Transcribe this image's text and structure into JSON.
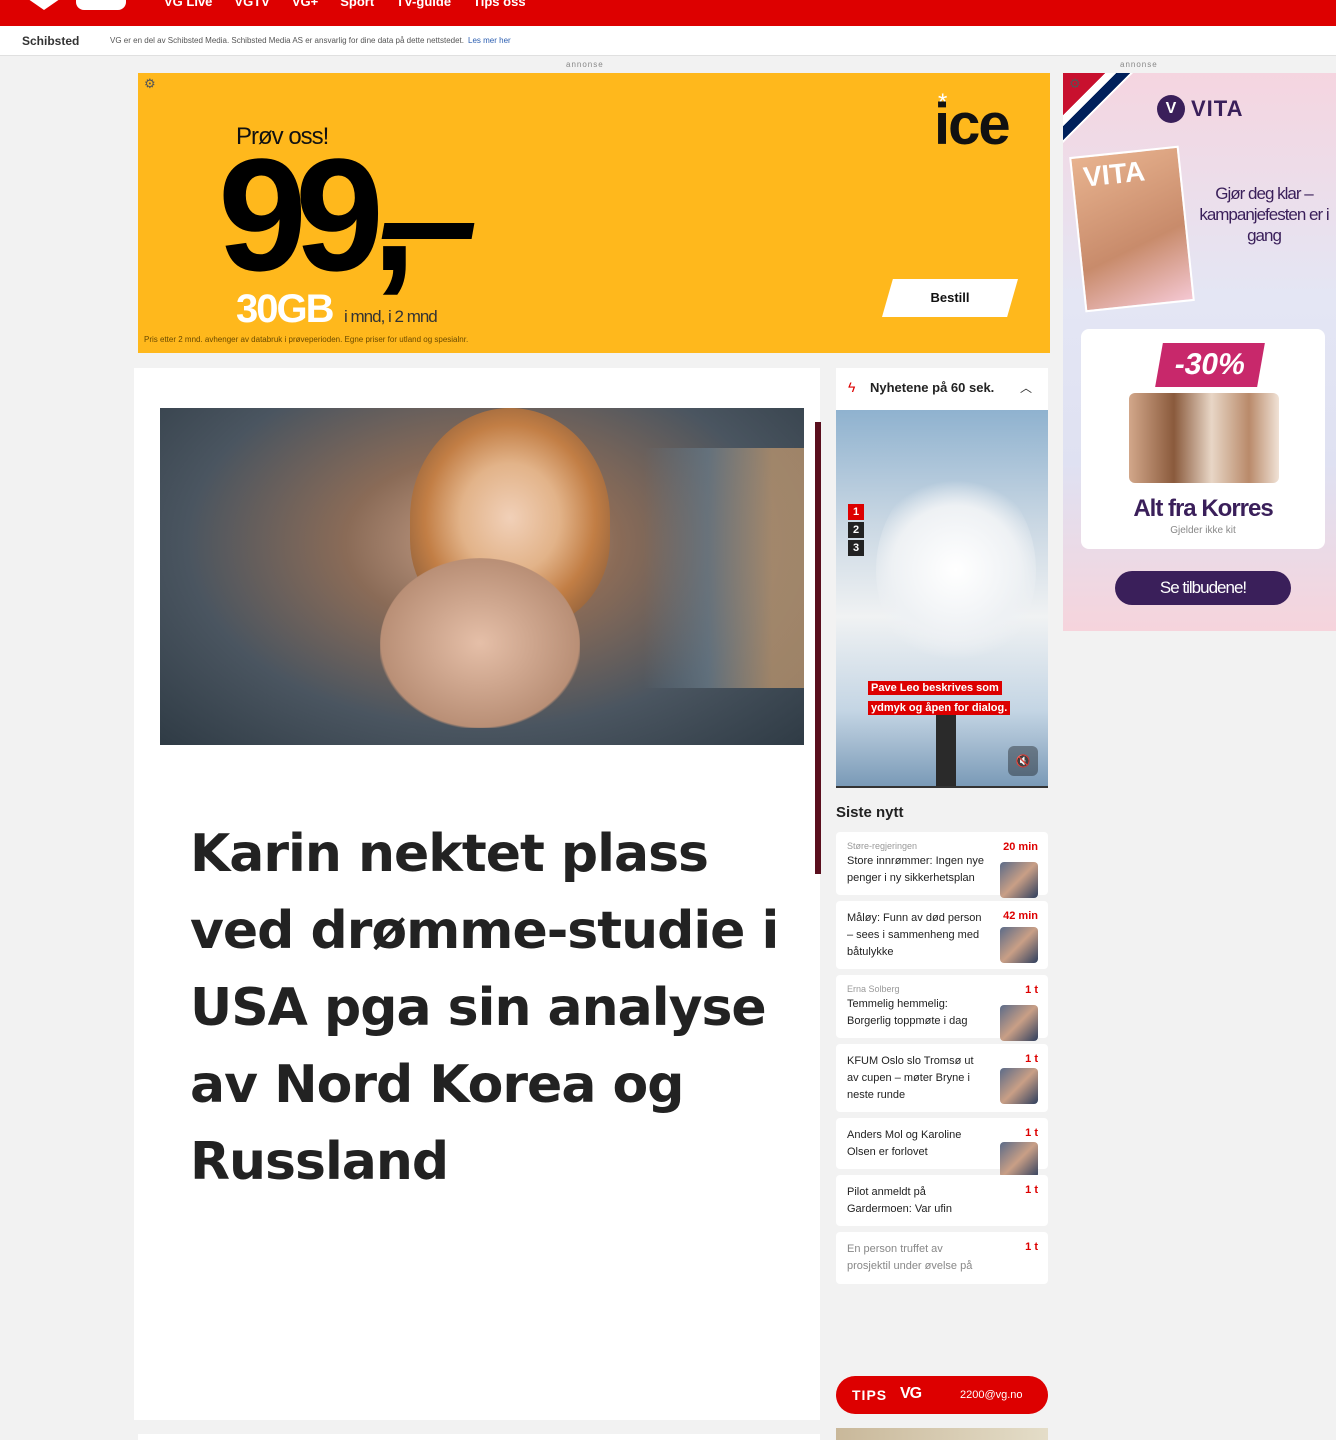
{
  "nav": {
    "links": [
      "VG Live",
      "VGTV",
      "VG+",
      "Sport",
      "TV-guide",
      "Tips oss"
    ]
  },
  "schibsted": {
    "logo": "Schibsted",
    "text": "VG er en del av Schibsted Media. Schibsted Media AS er ansvarlig for dine data på dette nettstedet.",
    "link": "Les mer her"
  },
  "ads": {
    "label": "annonse",
    "ice": {
      "prov": "Prøv oss!",
      "price": "99,",
      "gb": "30GB",
      "gb_sub": "i mnd, i 2 mnd",
      "logo": "ice",
      "button": "Bestill",
      "fine": "Pris etter 2 mnd. avhenger av databruk i prøveperioden. Egne priser for utland og spesialnr."
    },
    "vita": {
      "logo": "VITA",
      "mag": "VITA",
      "tagline": "Gjør deg klar – kampanjefesten er i gang",
      "badge": "-30%",
      "product": "Alt fra Korres",
      "note": "Gjelder ikke kit",
      "cta": "Se tilbudene!"
    }
  },
  "article": {
    "title": "Karin nektet plass ved drømme-studie i USA pga sin analyse av Nord Korea og Russland"
  },
  "news60": {
    "label": "Nyhetene på 60 sek.",
    "numbers": [
      "1",
      "2",
      "3"
    ],
    "caption": "Pave Leo beskrives som ydmyk og åpen for dialog."
  },
  "siste": {
    "heading": "Siste nytt",
    "items": [
      {
        "kicker": "Støre-regjeringen",
        "title": "Store innrømmer: Ingen nye penger i ny sikkerhetsplan",
        "time": "20 min"
      },
      {
        "kicker": "",
        "title": "Måløy: Funn av død person – sees i sammenheng med båtulykke",
        "time": "42 min"
      },
      {
        "kicker": "Erna Solberg",
        "title": "Temmelig hemmelig: Borgerlig toppmøte i dag",
        "time": "1 t"
      },
      {
        "kicker": "",
        "title": "KFUM Oslo slo Tromsø ut av cupen – møter Bryne i neste runde",
        "time": "1 t"
      },
      {
        "kicker": "",
        "title": "Anders Mol og Karoline Olsen er forlovet",
        "time": "1 t"
      },
      {
        "kicker": "",
        "title": "Pilot anmeldt på Gardermoen: Var ufin",
        "time": "1 t"
      },
      {
        "kicker": "",
        "title": "En person truffet av prosjektil under øvelse på",
        "time": "1 t"
      }
    ]
  },
  "tips": {
    "label": "TIPS",
    "brand": "VG",
    "contact": "2200@vg.no"
  }
}
